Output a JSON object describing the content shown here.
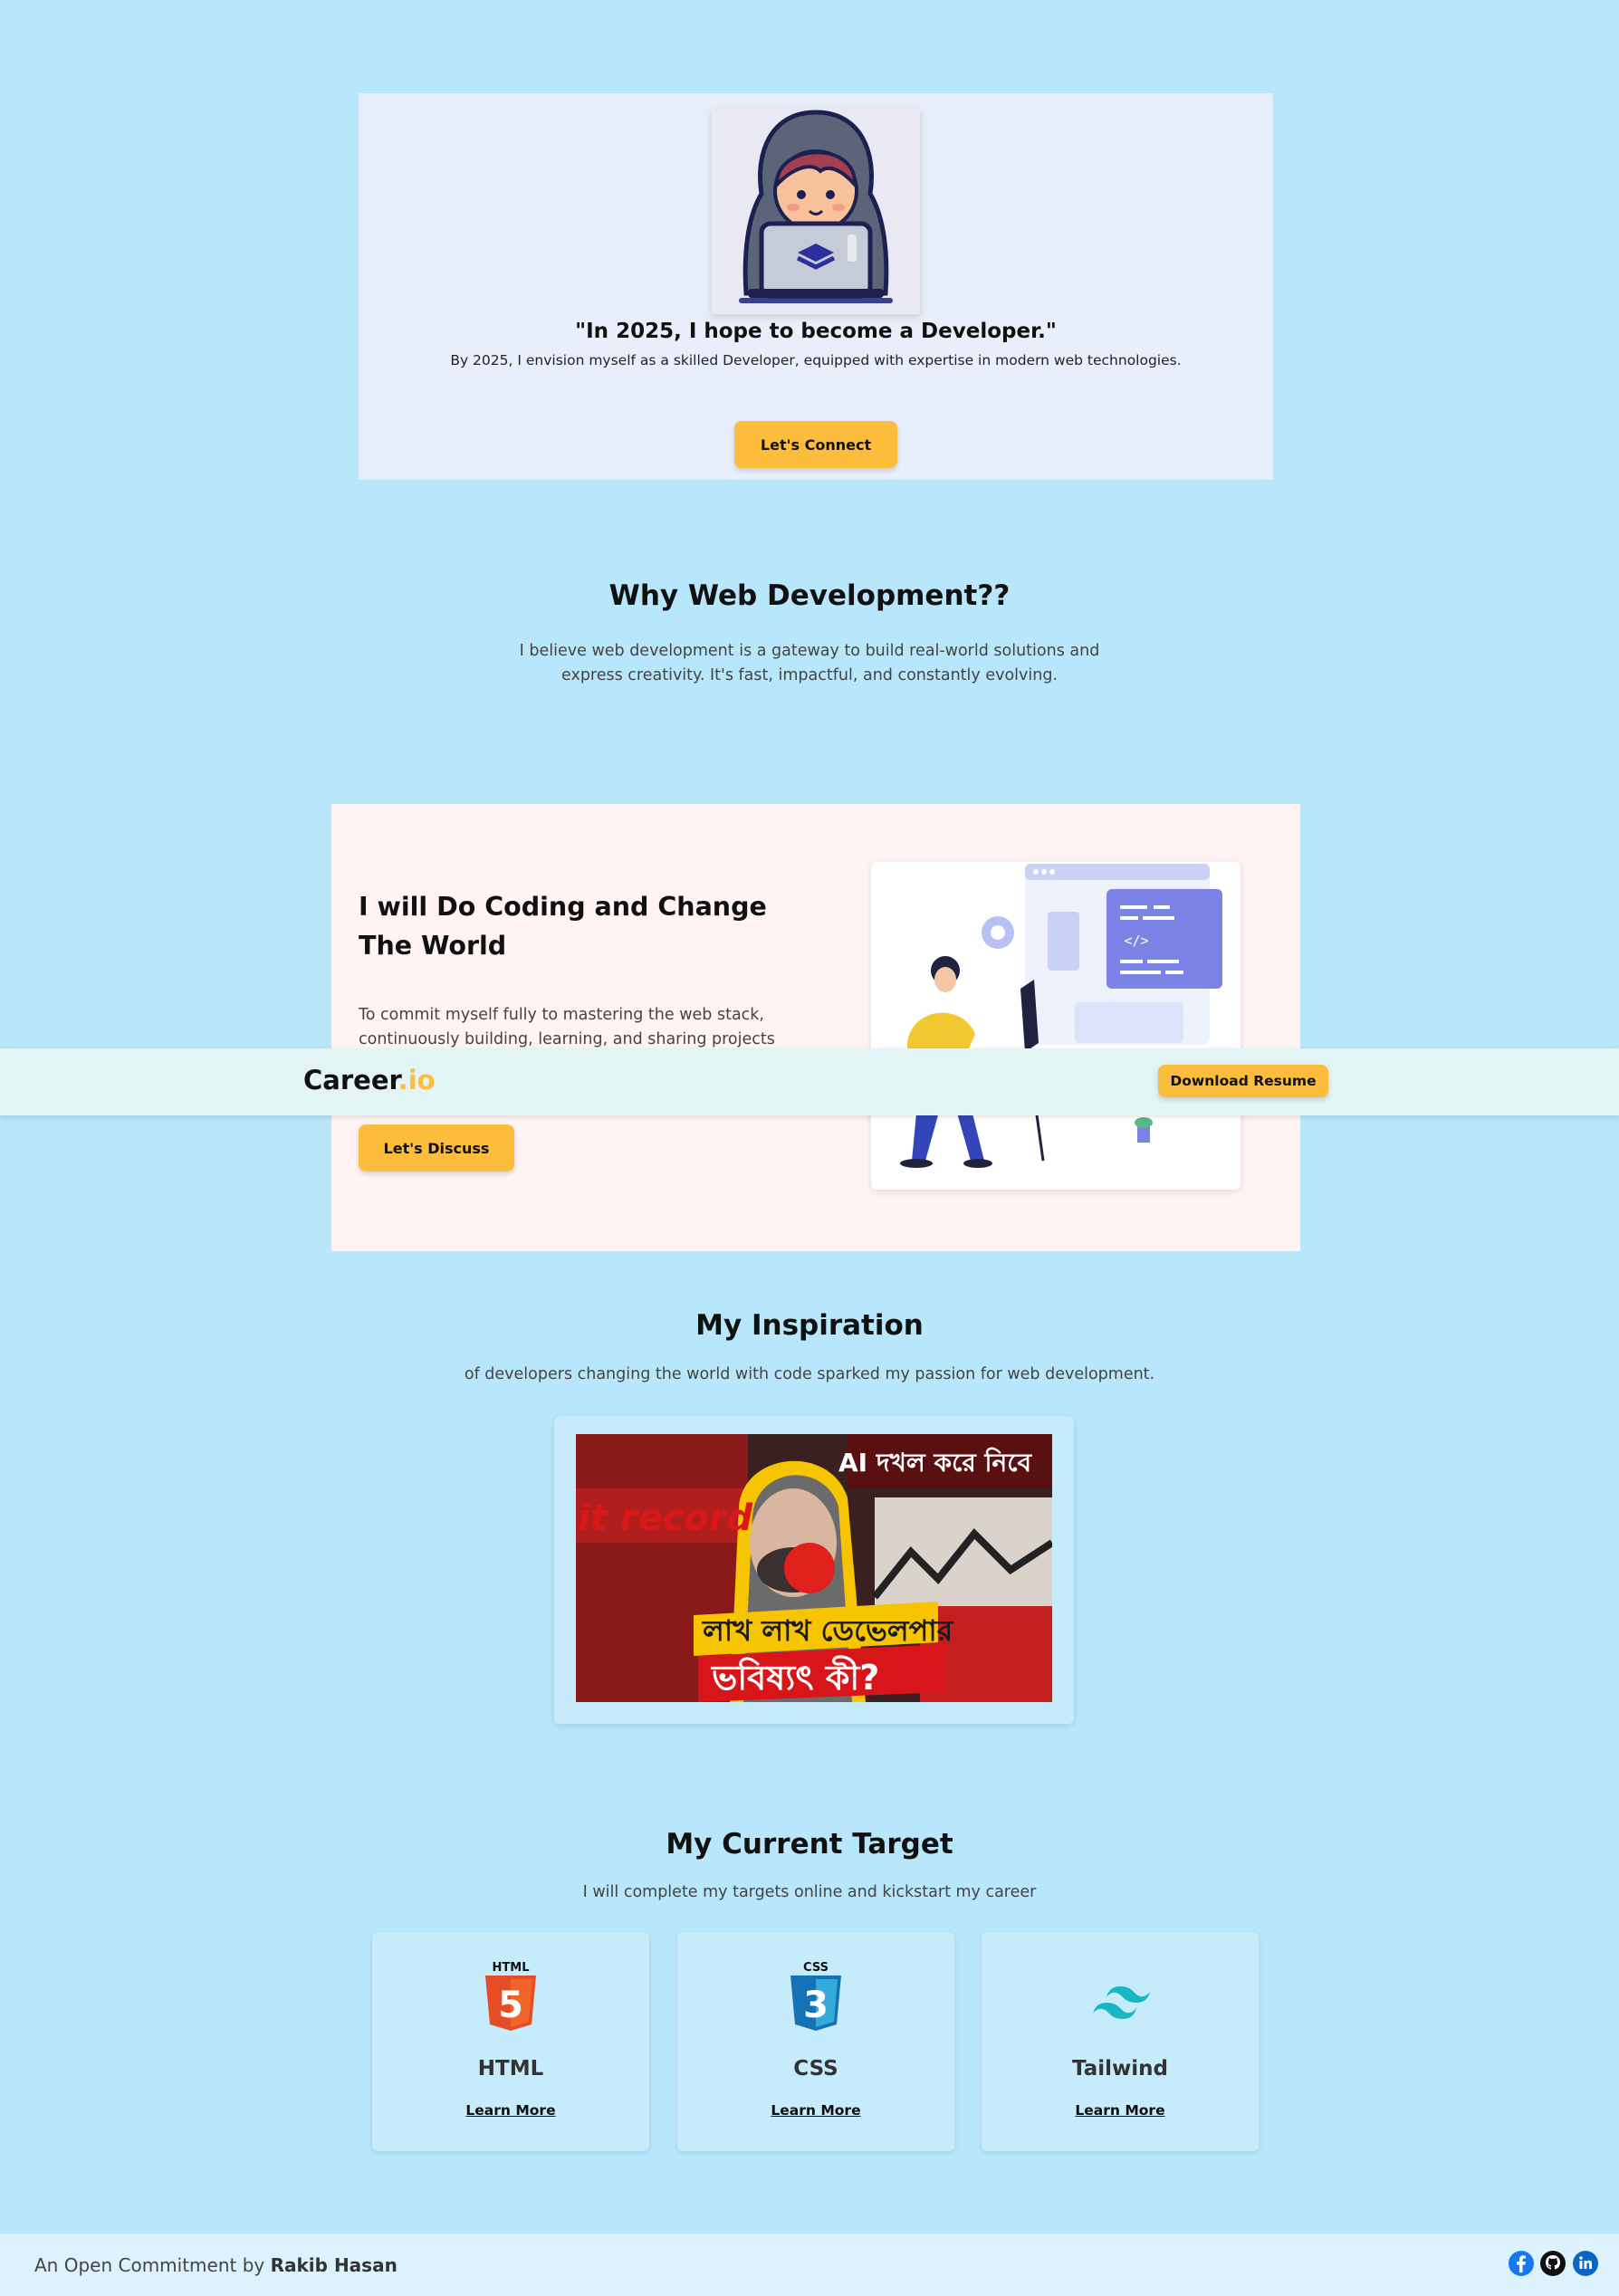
{
  "hero": {
    "title": "\"In 2025, I hope to become a Developer.\"",
    "subtitle": "By 2025, I envision myself as a skilled Developer, equipped with expertise in modern web technologies.",
    "connect_label": "Let's Connect"
  },
  "why": {
    "title": "Why Web Development??",
    "text": "I believe web development is a gateway to build real-world solutions and express creativity. It's fast, impactful, and constantly evolving."
  },
  "coding": {
    "title": "I will Do Coding and Change The World",
    "text": "To commit myself fully to mastering the web stack, continuously building, learning, and sharing projects that",
    "discuss_label": "Let's Discuss"
  },
  "nav": {
    "logo_main": "Career",
    "logo_suffix": ".io",
    "resume_label": "Download Resume"
  },
  "inspiration": {
    "title": "My Inspiration",
    "text": "of developers changing the world with code sparked my passion for web development.",
    "thumb_line1": "লাখ লাখ ডেভেলপার",
    "thumb_line2": "ভবিষ্যৎ কী?",
    "thumb_top_right": "AI দখল করে নিবে",
    "thumb_record": "it record"
  },
  "target": {
    "title": "My Current Target",
    "text": "I will complete my targets online and kickstart my career",
    "cards": [
      {
        "name": "HTML",
        "link": "Learn More",
        "badge": "HTML",
        "glyph": "5",
        "icon": "html5-icon"
      },
      {
        "name": "CSS",
        "link": "Learn More",
        "badge": "CSS",
        "glyph": "3",
        "icon": "css3-icon"
      },
      {
        "name": "Tailwind",
        "link": "Learn More",
        "icon": "tailwind-icon"
      }
    ]
  },
  "footer": {
    "prefix": "An Open Commitment by ",
    "author": "Rakib Hasan",
    "socials": [
      "facebook-icon",
      "github-icon",
      "linkedin-icon"
    ]
  },
  "colors": {
    "background": "#b8e6fb",
    "accent": "#fbbd3b",
    "hero_bg": "#e8eefa",
    "coding_bg": "#fff4f3",
    "navbar_bg": "#e2f4f3",
    "card_bg": "#c6ebfb"
  }
}
